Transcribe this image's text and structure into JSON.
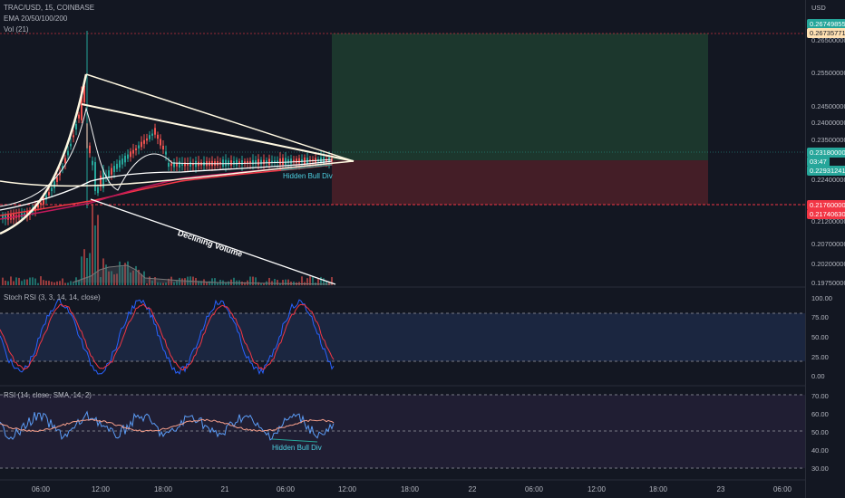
{
  "header": {
    "symbol": "TRAC/USD, 15, COINBASE",
    "ema_label": "EMA 20/50/100/200",
    "vol_label": "Vol (21)",
    "currency": "USD"
  },
  "price_axis": {
    "ticks": [
      "0.26500000",
      "0.25500000",
      "0.24500000",
      "0.24000000",
      "0.23500000",
      "0.22400000",
      "0.21200000",
      "0.20700000",
      "0.20200000",
      "0.19750000"
    ],
    "tags": [
      {
        "text": "0.26749855",
        "color": "#26a69a",
        "kind": "tp"
      },
      {
        "text": "0.26735771",
        "color": "#ff9800",
        "kind": "tp2"
      },
      {
        "text": "0.23180000",
        "color": "#26a69a",
        "kind": "last"
      },
      {
        "text": "03:47",
        "color": "#26a69a",
        "kind": "time"
      },
      {
        "text": "0.22931241",
        "color": "#26a69a",
        "kind": "entry"
      },
      {
        "text": "0.21760000",
        "color": "#f23645",
        "kind": "sl"
      },
      {
        "text": "0.21740630",
        "color": "#f23645",
        "kind": "sl2"
      }
    ]
  },
  "annotations": {
    "hidden_bull_1": "Hidden Bull Div",
    "declining_volume": "Declining Volume",
    "hidden_bull_2": "Hidden Bull Div"
  },
  "stoch_panel": {
    "label": "Stoch RSI (3, 3, 14, 14, close)",
    "ticks": [
      "100.00",
      "75.00",
      "50.00",
      "25.00",
      "0.00"
    ]
  },
  "rsi_panel": {
    "label": "RSI (14, close, SMA, 14, 2)",
    "ticks": [
      "70.00",
      "60.00",
      "50.00",
      "40.00",
      "30.00"
    ]
  },
  "time_axis": {
    "labels": [
      "06:00",
      "12:00",
      "18:00",
      "21",
      "06:00",
      "12:00",
      "18:00",
      "22",
      "06:00",
      "12:00",
      "18:00",
      "23",
      "06:00"
    ]
  },
  "colors": {
    "bg": "#131722",
    "up": "#26a69a",
    "down": "#ef5350",
    "profit_zone": "#1e3b2f",
    "loss_zone": "#4a1f28",
    "stoch_k": "#2962ff",
    "stoch_d": "#f23645",
    "rsi_line": "#5b9cf6",
    "rsi_ma": "#f7a08c"
  }
}
